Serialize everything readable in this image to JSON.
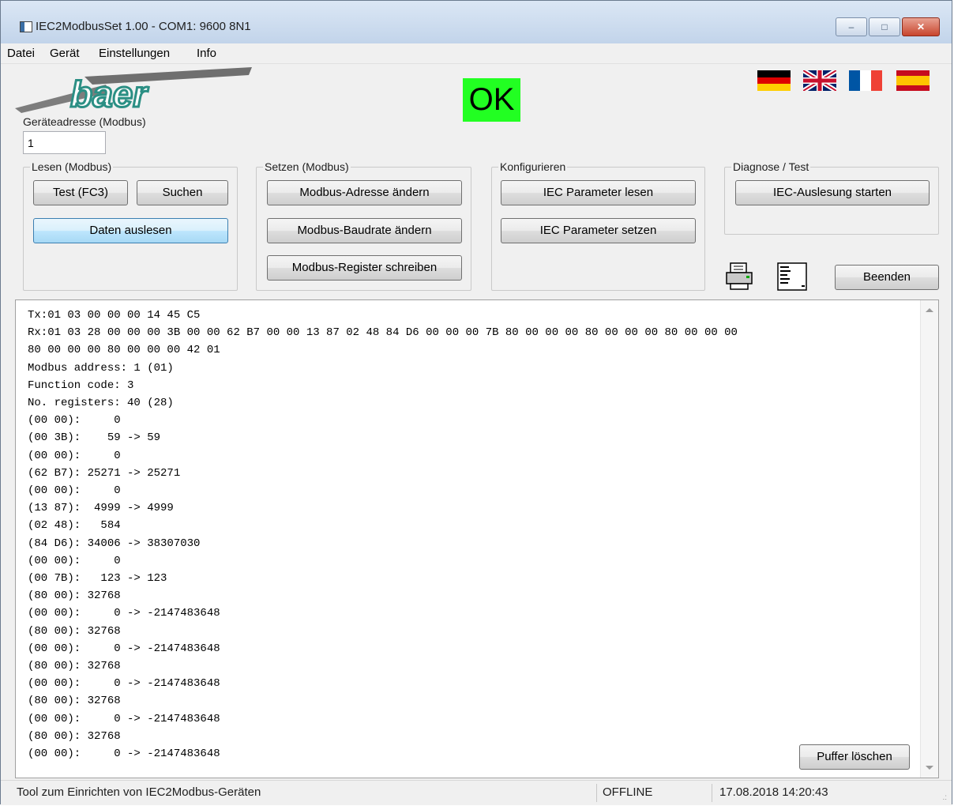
{
  "window": {
    "title": "IEC2ModbusSet 1.00 - COM1: 9600 8N1",
    "min_glyph": "–",
    "max_glyph": "□",
    "close_glyph": "✕"
  },
  "menu": [
    "Datei",
    "Gerät",
    "Einstellungen",
    "Info"
  ],
  "logo_text": "baer",
  "status_indicator": {
    "text": "OK",
    "color": "#22ff22"
  },
  "flags": [
    "german-flag",
    "uk-flag",
    "french-flag",
    "spanish-flag"
  ],
  "device_address": {
    "label": "Geräteadresse (Modbus)",
    "value": "1"
  },
  "groups": {
    "lesen": {
      "title": "Lesen (Modbus)",
      "test_button": "Test (FC3)",
      "search_button": "Suchen",
      "read_button": "Daten auslesen"
    },
    "setzen": {
      "title": "Setzen (Modbus)",
      "address_button": "Modbus-Adresse ändern",
      "baudrate_button": "Modbus-Baudrate ändern",
      "register_button": "Modbus-Register schreiben"
    },
    "konfigurieren": {
      "title": "Konfigurieren",
      "read_params_button": "IEC Parameter lesen",
      "set_params_button": "IEC Parameter setzen"
    },
    "diagnose": {
      "title": "Diagnose / Test",
      "start_button": "IEC-Auslesung starten"
    }
  },
  "toolbar": {
    "print_icon": "printer-icon",
    "list_icon": "list-view-icon",
    "exit_button": "Beenden"
  },
  "log": {
    "lines": [
      "Tx:01 03 00 00 00 14 45 C5",
      "Rx:01 03 28 00 00 00 3B 00 00 62 B7 00 00 13 87 02 48 84 D6 00 00 00 7B 80 00 00 00 80 00 00 00 80 00 00 00",
      "80 00 00 00 80 00 00 00 42 01",
      "Modbus address: 1 (01)",
      "Function code: 3",
      "No. registers: 40 (28)",
      "(00 00):     0",
      "(00 3B):    59 -> 59",
      "(00 00):     0",
      "(62 B7): 25271 -> 25271",
      "(00 00):     0",
      "(13 87):  4999 -> 4999",
      "(02 48):   584",
      "(84 D6): 34006 -> 38307030",
      "(00 00):     0",
      "(00 7B):   123 -> 123",
      "(80 00): 32768",
      "(00 00):     0 -> -2147483648",
      "(80 00): 32768",
      "(00 00):     0 -> -2147483648",
      "(80 00): 32768",
      "(00 00):     0 -> -2147483648",
      "(80 00): 32768",
      "(00 00):     0 -> -2147483648",
      "(80 00): 32768",
      "(00 00):     0 -> -2147483648"
    ],
    "clear_button": "Puffer löschen"
  },
  "statusbar": {
    "description": "Tool zum Einrichten von IEC2Modbus-Geräten",
    "connection": "OFFLINE",
    "datetime": "17.08.2018 14:20:43"
  }
}
